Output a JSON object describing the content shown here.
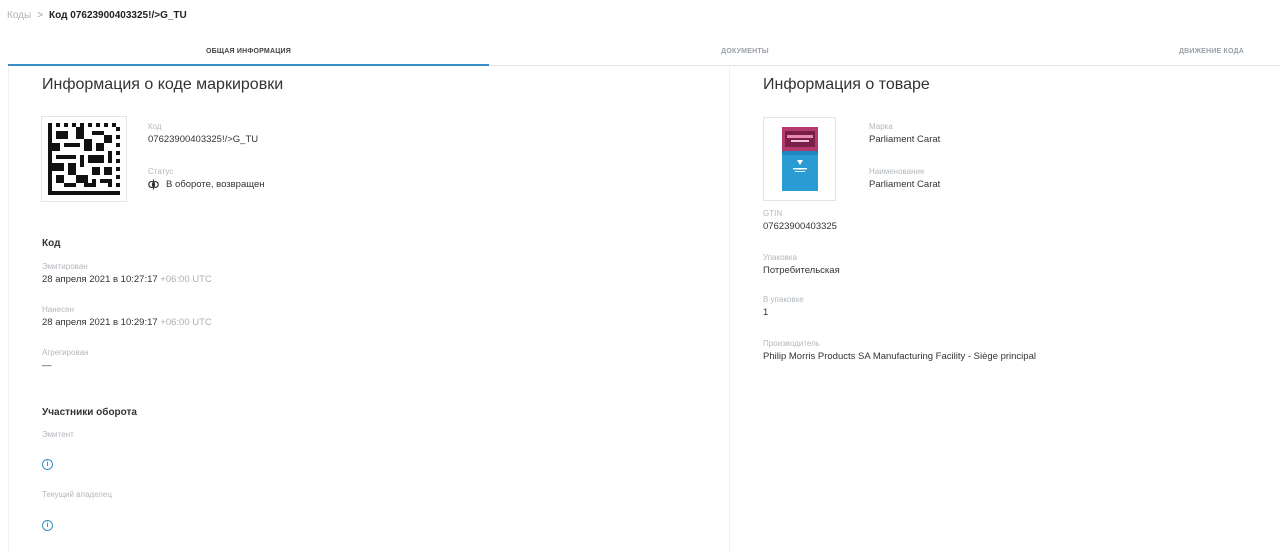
{
  "breadcrumb": {
    "root": "Коды",
    "separator": ">",
    "current": "Код 07623900403325!/>G_TU"
  },
  "tabs": [
    {
      "label": "ОБЩАЯ ИНФОРМАЦИЯ",
      "active": true
    },
    {
      "label": "ДОКУМЕНТЫ",
      "active": false
    },
    {
      "label": "ДВИЖЕНИЕ КОДА",
      "active": false
    }
  ],
  "code_info": {
    "title": "Информация о коде маркировки",
    "code_label": "Код",
    "code_value": "07623900403325!/>G_TU",
    "status_label": "Статус",
    "status_value": "В обороте, возвращен",
    "status_icon": "circulation-icon"
  },
  "code_section": {
    "heading": "Код",
    "emitted_label": "Эмитирован",
    "emitted_value": "28 апреля 2021 в 10:27:17",
    "emitted_tz": "+06:00 UTC",
    "applied_label": "Нанесен",
    "applied_value": "28 апреля 2021 в 10:29:17",
    "applied_tz": "+06:00 UTC",
    "aggregated_label": "Агрегирован",
    "aggregated_value": "—"
  },
  "participants": {
    "heading": "Участники оборота",
    "emitter_label": "Эмитент",
    "owner_label": "Текущий владелец",
    "info_glyph": "i"
  },
  "product": {
    "title": "Информация о товаре",
    "brand_label": "Марка",
    "brand_value": "Parliament Carat",
    "name_label": "Наименование",
    "name_value": "Parliament Carat",
    "gtin_label": "GTIN",
    "gtin_value": "07623900403325",
    "package_label": "Упаковка",
    "package_value": "Потребительская",
    "in_package_label": "В упаковке",
    "in_package_value": "1",
    "manufacturer_label": "Производитель",
    "manufacturer_value": "Philip Morris Products SA Manufacturing Facility - Siège principal"
  },
  "colors": {
    "accent": "#3a8fc7",
    "text": "#333333",
    "muted": "#b3b8bd",
    "border": "#e3e6e9"
  }
}
